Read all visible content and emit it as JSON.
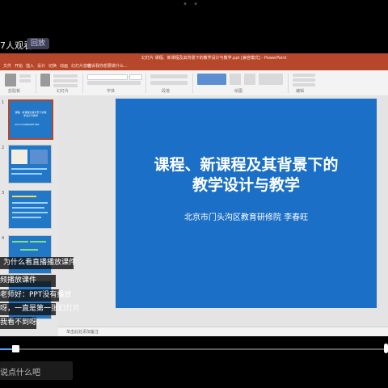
{
  "overlay": {
    "viewer_count": "7人观看",
    "live_badge": "回放"
  },
  "ppt": {
    "doc_title": "幻灯片    课程、新课程及其背景下的教学设计与教学.ppt [兼容模式] - PowerPoint",
    "tabs": [
      "文件",
      "开始",
      "插入",
      "设计",
      "切换",
      "动画",
      "幻灯片放映",
      "审阅",
      "视图"
    ],
    "tell_me": "告诉我你想要做什么...",
    "ribbon_groups": [
      "剪贴板",
      "幻灯片",
      "字体",
      "段落",
      "绘图",
      "编辑"
    ],
    "notes_placeholder": "单击此处添加备注",
    "thumb_numbers": [
      "1",
      "2",
      "3",
      "4",
      "5"
    ],
    "thumb1_title": "课程、新课程及其背景下的教学设计与教学",
    "thumb1_sub": "北京市门头沟区教育研修院   李春旺"
  },
  "slide": {
    "title_line1": "课程、新课程及其背景下的",
    "title_line2": "教学设计与教学",
    "subtitle": "北京市门头沟区教育研修院    李春旺",
    "background_color": "#1b6fc6"
  },
  "captions": [
    "为什么看直播播放课件",
    "频播放课件",
    "老师好：PPT没有播放",
    "呀，一直是第一张幻灯片",
    "我看不到呀。"
  ],
  "video": {
    "progress_fraction": 0.04
  },
  "comment": {
    "placeholder": "说点什么吧"
  }
}
